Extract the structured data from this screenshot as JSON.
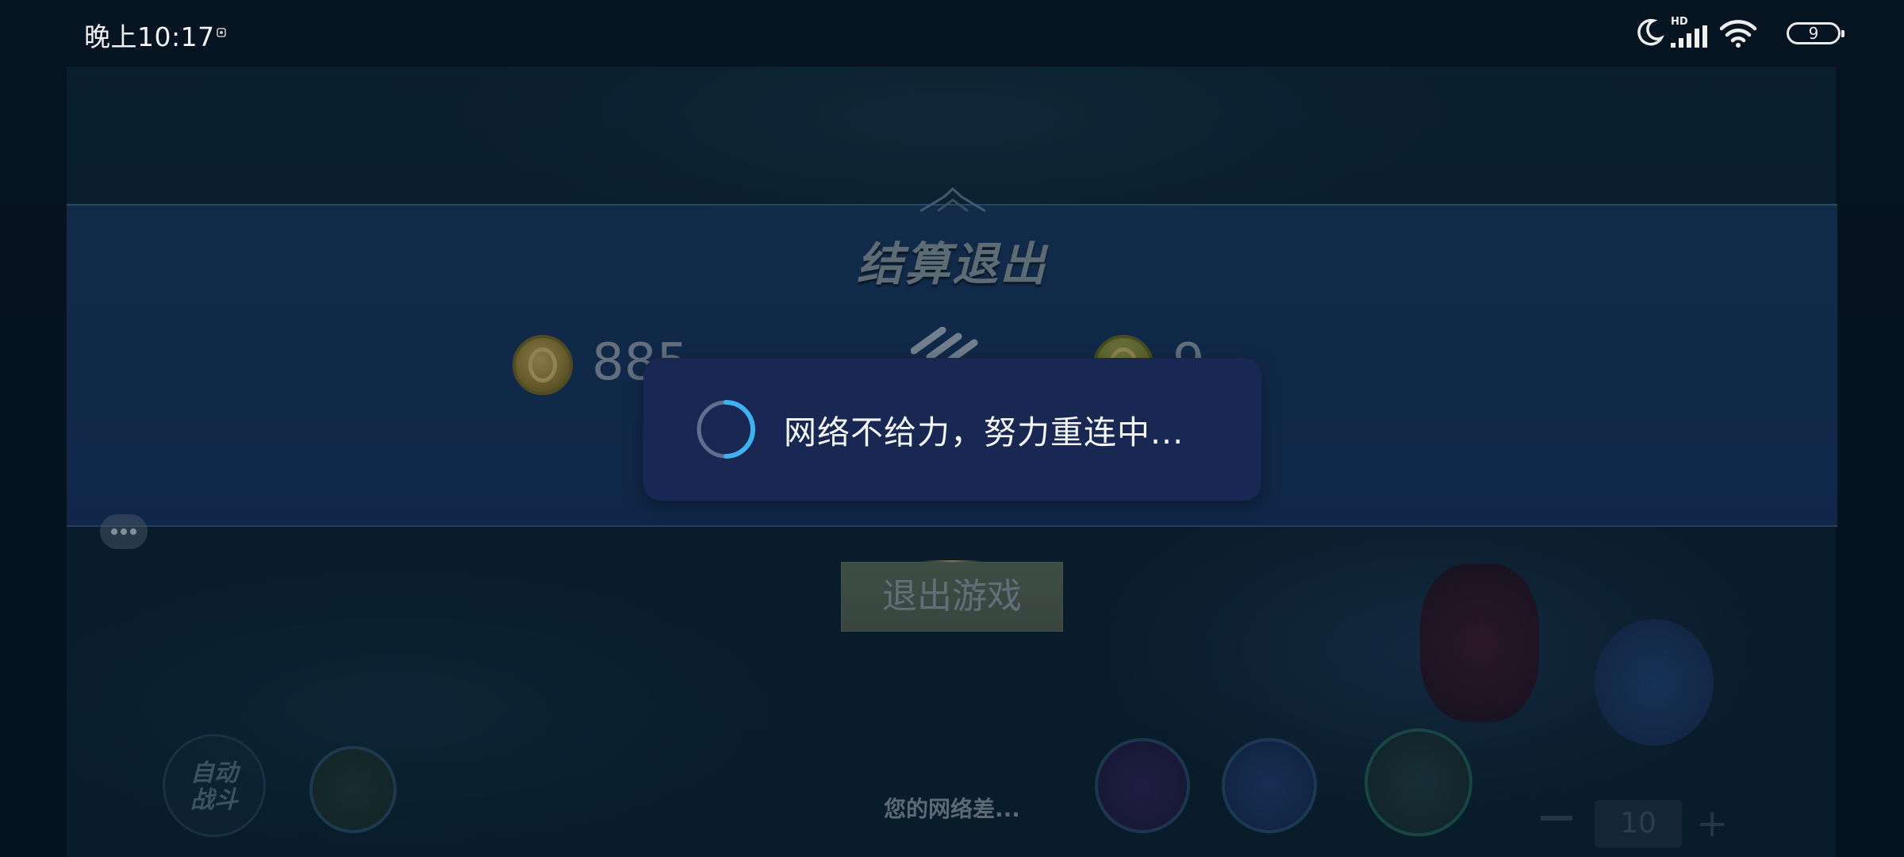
{
  "status_bar": {
    "time": "晚上10:17",
    "battery": "9",
    "network_badge": "HD",
    "icons": [
      "notification-icon",
      "moon-icon",
      "signal-icon",
      "wifi-icon",
      "battery-icon"
    ]
  },
  "settlement": {
    "title": "结算退出",
    "coin_left_value": "885",
    "coin_right_value": "9",
    "exit_button_label": "退出游戏"
  },
  "toast": {
    "message": "网络不给力，努力重连中...",
    "icon": "loading-spinner-icon"
  },
  "bottom": {
    "network_hint": "您的网络差...",
    "auto_battle_label_line1": "自动",
    "auto_battle_label_line2": "战斗",
    "zoom_value": "10"
  },
  "colors": {
    "toast_bg": "#192852",
    "panel_bg": "#16355a",
    "spinner_accent": "#3fb0f0"
  }
}
